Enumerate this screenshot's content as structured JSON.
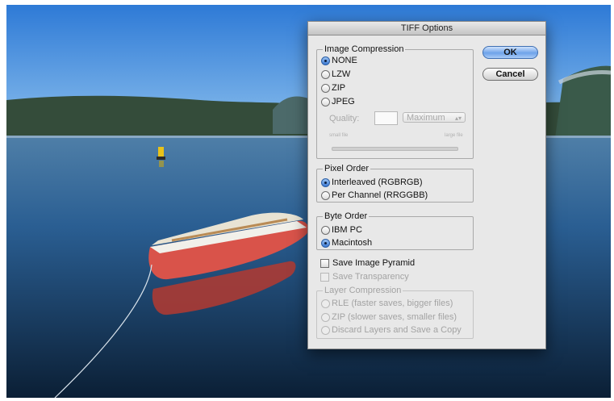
{
  "dialog": {
    "title": "TIFF Options",
    "ok_label": "OK",
    "cancel_label": "Cancel",
    "compression": {
      "legend": "Image Compression",
      "options": [
        "NONE",
        "LZW",
        "ZIP",
        "JPEG"
      ],
      "selected": "NONE",
      "quality_label": "Quality:",
      "quality_value": "",
      "quality_preset": "Maximum",
      "small_file_label": "small file",
      "large_file_label": "large file"
    },
    "pixel_order": {
      "legend": "Pixel Order",
      "options": [
        "Interleaved (RGBRGB)",
        "Per Channel (RRGGBB)"
      ],
      "selected": "Interleaved (RGBRGB)"
    },
    "byte_order": {
      "legend": "Byte Order",
      "options": [
        "IBM PC",
        "Macintosh"
      ],
      "selected": "Macintosh"
    },
    "save_image_pyramid": "Save Image Pyramid",
    "save_transparency": "Save Transparency",
    "layer_compression": {
      "legend": "Layer Compression",
      "options": [
        "RLE (faster saves, bigger files)",
        "ZIP (slower saves, smaller files)",
        "Discard Layers and Save a Copy"
      ]
    }
  },
  "colors": {
    "accent": "#4a86dc",
    "sky": "#3f8ad8",
    "boat": "#d9534a"
  }
}
